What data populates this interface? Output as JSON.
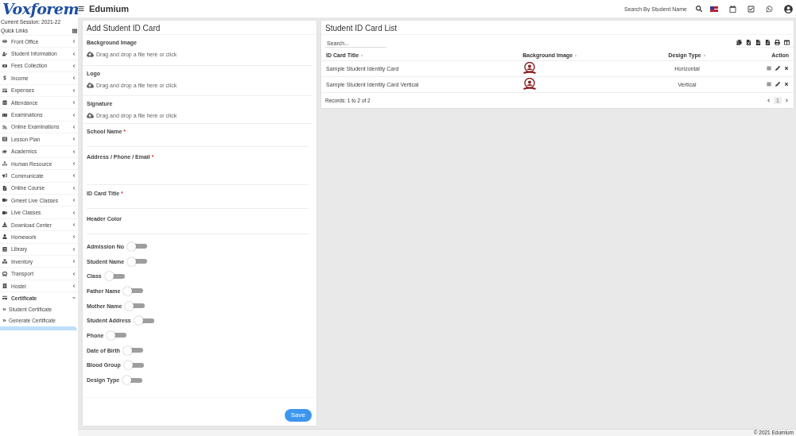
{
  "header": {
    "logo": "Voxforem",
    "app_name": "Edumium",
    "search": {
      "placeholder": "Search By Student Name"
    }
  },
  "sidebar": {
    "session": "Current Session: 2021-22",
    "quick_links": "Quick Links",
    "items": [
      {
        "label": "Front Office",
        "expanded": false
      },
      {
        "label": "Student Information",
        "expanded": false
      },
      {
        "label": "Fees Collection",
        "expanded": false
      },
      {
        "label": "Income",
        "expanded": false
      },
      {
        "label": "Expenses",
        "expanded": false
      },
      {
        "label": "Attendance",
        "expanded": false
      },
      {
        "label": "Examinations",
        "expanded": false
      },
      {
        "label": "Online Examinations",
        "expanded": false
      },
      {
        "label": "Lesson Plan",
        "expanded": false
      },
      {
        "label": "Academics",
        "expanded": false
      },
      {
        "label": "Human Resource",
        "expanded": false
      },
      {
        "label": "Communicate",
        "expanded": false
      },
      {
        "label": "Online Course",
        "expanded": false
      },
      {
        "label": "Gmeet Live Classes",
        "expanded": false
      },
      {
        "label": "Live Classes",
        "expanded": false
      },
      {
        "label": "Download Center",
        "expanded": false
      },
      {
        "label": "Homework",
        "expanded": false
      },
      {
        "label": "Library",
        "expanded": false
      },
      {
        "label": "Inventory",
        "expanded": false
      },
      {
        "label": "Transport",
        "expanded": false
      },
      {
        "label": "Hostel",
        "expanded": false
      },
      {
        "label": "Certificate",
        "expanded": true,
        "children": [
          {
            "label": "Student Certificate",
            "selected": false
          },
          {
            "label": "Generate Certificate",
            "selected": false
          }
        ]
      }
    ]
  },
  "form": {
    "title": "Add Student ID Card",
    "uploads": [
      {
        "label": "Background Image",
        "hint": "Drag and drop a file here or click"
      },
      {
        "label": "Logo",
        "hint": "Drag and drop a file here or click"
      },
      {
        "label": "Signature",
        "hint": "Drag and drop a file here or click"
      }
    ],
    "fields": [
      {
        "label": "School Name",
        "mark": "*",
        "kind": "text"
      },
      {
        "label": "Address / Phone / Email",
        "mark": "*",
        "kind": "textarea"
      },
      {
        "label": "ID Card Title",
        "mark": "*",
        "kind": "text"
      },
      {
        "label": "Header Color",
        "kind": "text"
      }
    ],
    "toggles": [
      {
        "label": "Admission No",
        "on": false
      },
      {
        "label": "Student Name",
        "on": false
      },
      {
        "label": "Class",
        "on": false
      },
      {
        "label": "Father Name",
        "on": false
      },
      {
        "label": "Mother Name",
        "on": false
      },
      {
        "label": "Student Address",
        "on": false
      },
      {
        "label": "Phone",
        "on": false
      },
      {
        "label": "Date of Birth",
        "on": false
      },
      {
        "label": "Blood Group",
        "on": false
      },
      {
        "label": "Design Type",
        "on": false
      }
    ],
    "save": "Save"
  },
  "list": {
    "title": "Student ID Card List",
    "search": {
      "placeholder": "Search..."
    },
    "columns": [
      "ID Card Title",
      "Background Image",
      "Design Type",
      "Action"
    ],
    "rows": [
      {
        "title": "Sample Student Identity Card",
        "design_type": "Horizontal"
      },
      {
        "title": "Sample Student Identity Card Vertical",
        "design_type": "Vertical"
      }
    ],
    "records": "Records: 1 to 2 of 2",
    "page": "1"
  },
  "footer": "© 2021 Edumium"
}
